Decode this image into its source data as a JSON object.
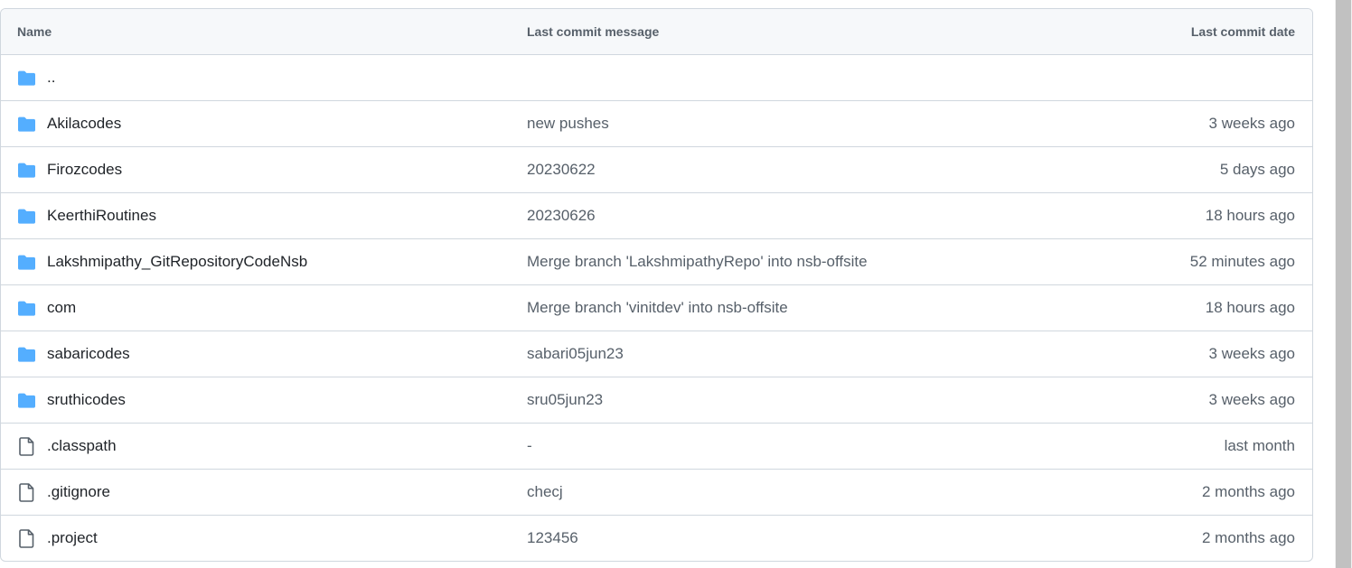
{
  "table": {
    "headers": {
      "name": "Name",
      "message": "Last commit message",
      "date": "Last commit date"
    },
    "rows": [
      {
        "type": "folder",
        "name": "..",
        "message": "",
        "date": ""
      },
      {
        "type": "folder",
        "name": "Akilacodes",
        "message": "new pushes",
        "date": "3 weeks ago"
      },
      {
        "type": "folder",
        "name": "Firozcodes",
        "message": "20230622",
        "date": "5 days ago"
      },
      {
        "type": "folder",
        "name": "KeerthiRoutines",
        "message": "20230626",
        "date": "18 hours ago"
      },
      {
        "type": "folder",
        "name": "Lakshmipathy_GitRepositoryCodeNsb",
        "message": "Merge branch 'LakshmipathyRepo' into nsb-offsite",
        "date": "52 minutes ago"
      },
      {
        "type": "folder",
        "name": "com",
        "message": "Merge branch 'vinitdev' into nsb-offsite",
        "date": "18 hours ago"
      },
      {
        "type": "folder",
        "name": "sabaricodes",
        "message": "sabari05jun23",
        "date": "3 weeks ago"
      },
      {
        "type": "folder",
        "name": "sruthicodes",
        "message": "sru05jun23",
        "date": "3 weeks ago"
      },
      {
        "type": "file",
        "name": ".classpath",
        "message": "-",
        "date": "last month"
      },
      {
        "type": "file",
        "name": ".gitignore",
        "message": "checj",
        "date": "2 months ago"
      },
      {
        "type": "file",
        "name": ".project",
        "message": "123456",
        "date": "2 months ago"
      }
    ]
  },
  "icons": {
    "folder": "folder-icon",
    "file": "file-icon"
  },
  "colors": {
    "folder_icon": "#54aeff",
    "file_icon": "#57606a",
    "border": "#d0d7de",
    "header_bg": "#f6f8fa"
  }
}
